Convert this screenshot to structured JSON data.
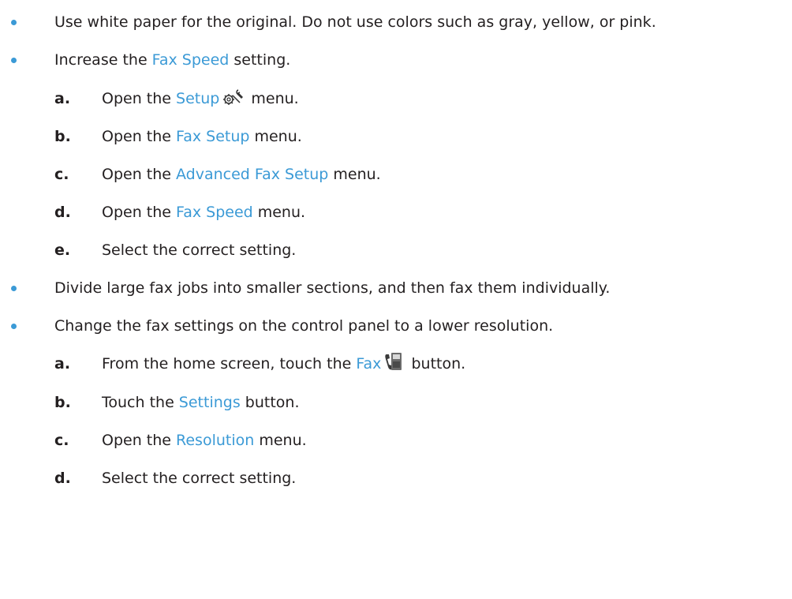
{
  "colors": {
    "bullet": "#3b9ad6",
    "highlight": "#3b9ad6",
    "text": "#231f20"
  },
  "bullets": [
    {
      "text": "Use white paper for the original. Do not use colors such as gray, yellow, or pink."
    },
    {
      "pre": "Increase the ",
      "hl": "Fax Speed",
      "post": " setting."
    },
    {
      "text": "Divide large fax jobs into smaller sections, and then fax them individually."
    },
    {
      "text": "Change the fax settings on the control panel to a lower resolution."
    }
  ],
  "steps_speed": [
    {
      "letter": "a.",
      "pre": "Open the ",
      "hl": "Setup",
      "icon": "setup-wrench-icon",
      "post": " menu."
    },
    {
      "letter": "b.",
      "pre": "Open the ",
      "hl": "Fax Setup",
      "post": " menu."
    },
    {
      "letter": "c.",
      "pre": "Open the ",
      "hl": "Advanced Fax Setup",
      "post": " menu."
    },
    {
      "letter": "d.",
      "pre": "Open the ",
      "hl": "Fax Speed",
      "post": " menu."
    },
    {
      "letter": "e.",
      "text": "Select the correct setting."
    }
  ],
  "steps_resolution": [
    {
      "letter": "a.",
      "pre": "From the home screen, touch the ",
      "hl": "Fax",
      "icon": "fax-machine-icon",
      "post": " button."
    },
    {
      "letter": "b.",
      "pre": "Touch the ",
      "hl": "Settings",
      "post": " button."
    },
    {
      "letter": "c.",
      "pre": "Open the ",
      "hl": "Resolution",
      "post": " menu."
    },
    {
      "letter": "d.",
      "text": "Select the correct setting."
    }
  ]
}
